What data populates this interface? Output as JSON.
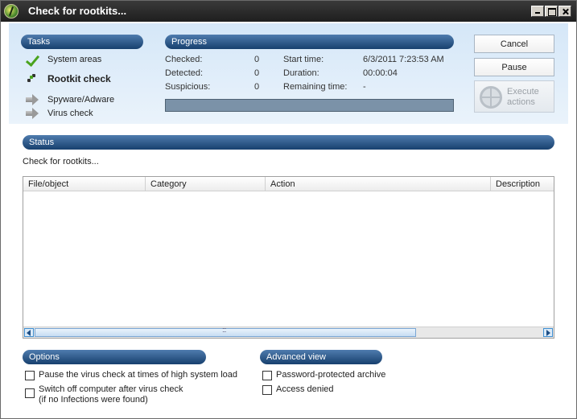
{
  "window": {
    "title": "Check for rootkits..."
  },
  "tasks": {
    "header": "Tasks",
    "items": [
      {
        "label": "System areas",
        "state": "done"
      },
      {
        "label": "Rootkit check",
        "state": "running"
      },
      {
        "label": "Spyware/Adware",
        "state": "pending"
      },
      {
        "label": "Virus check",
        "state": "pending"
      }
    ]
  },
  "progress": {
    "header": "Progress",
    "checked_label": "Checked:",
    "checked_value": "0",
    "detected_label": "Detected:",
    "detected_value": "0",
    "suspicious_label": "Suspicious:",
    "suspicious_value": "0",
    "start_label": "Start time:",
    "start_value": "6/3/2011 7:23:53 AM",
    "duration_label": "Duration:",
    "duration_value": "00:00:04",
    "remaining_label": "Remaining time:",
    "remaining_value": "-",
    "fraction": 0
  },
  "buttons": {
    "cancel": "Cancel",
    "pause": "Pause",
    "execute_line1": "Execute",
    "execute_line2": "actions"
  },
  "status": {
    "header": "Status",
    "text": "Check for rootkits...",
    "columns": [
      "File/object",
      "Category",
      "Action",
      "Description"
    ]
  },
  "options": {
    "header": "Options",
    "pause_label": "Pause the virus check at times of high system load",
    "shutdown_line1": "Switch off computer after virus check",
    "shutdown_line2": "(if no Infections were found)"
  },
  "advanced": {
    "header": "Advanced view",
    "archive_label": "Password-protected archive",
    "access_label": "Access denied"
  },
  "colors": {
    "header_pill": "#17406e",
    "panel_bg": "#d5e7f8",
    "done_check": "#4aa31d"
  }
}
